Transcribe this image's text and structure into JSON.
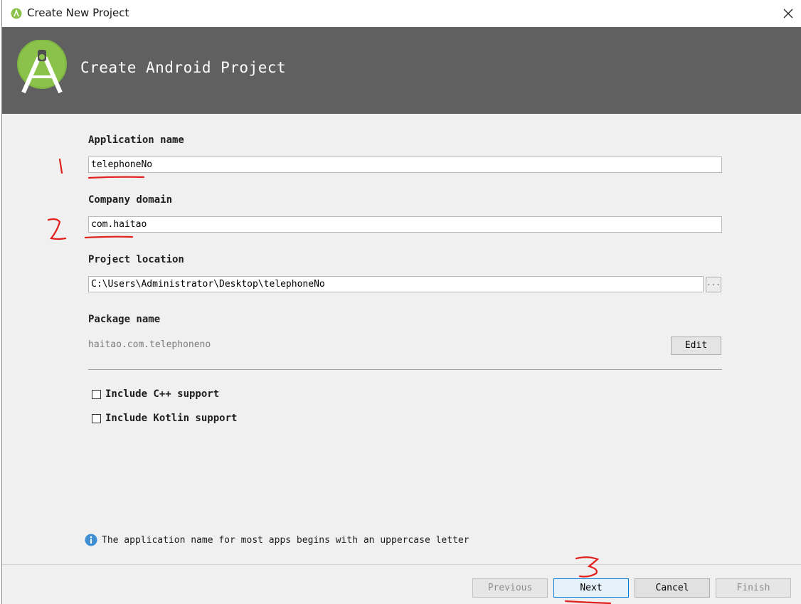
{
  "window": {
    "title": "Create New Project"
  },
  "header": {
    "title": "Create Android Project"
  },
  "form": {
    "app_name_label": "Application name",
    "app_name_value": "telephoneNo",
    "company_domain_label": "Company domain",
    "company_domain_value": "com.haitao",
    "project_location_label": "Project location",
    "project_location_value": "C:\\Users\\Administrator\\Desktop\\telephoneNo",
    "browse_label": "...",
    "package_name_label": "Package name",
    "package_name_value": "haitao.com.telephoneno",
    "edit_label": "Edit",
    "cpp_support_label": "Include C++ support",
    "cpp_support_checked": false,
    "kotlin_support_label": "Include Kotlin support",
    "kotlin_support_checked": false
  },
  "hint": {
    "text": "The application name for most apps begins with an uppercase letter",
    "icon": "info-icon"
  },
  "buttons": {
    "previous": "Previous",
    "next": "Next",
    "cancel": "Cancel",
    "finish": "Finish"
  },
  "annotations": {
    "marker_color": "#e0201c"
  },
  "colors": {
    "header_bg": "#606060",
    "android_green": "#8bc34a",
    "focus_blue": "#0078d7"
  }
}
